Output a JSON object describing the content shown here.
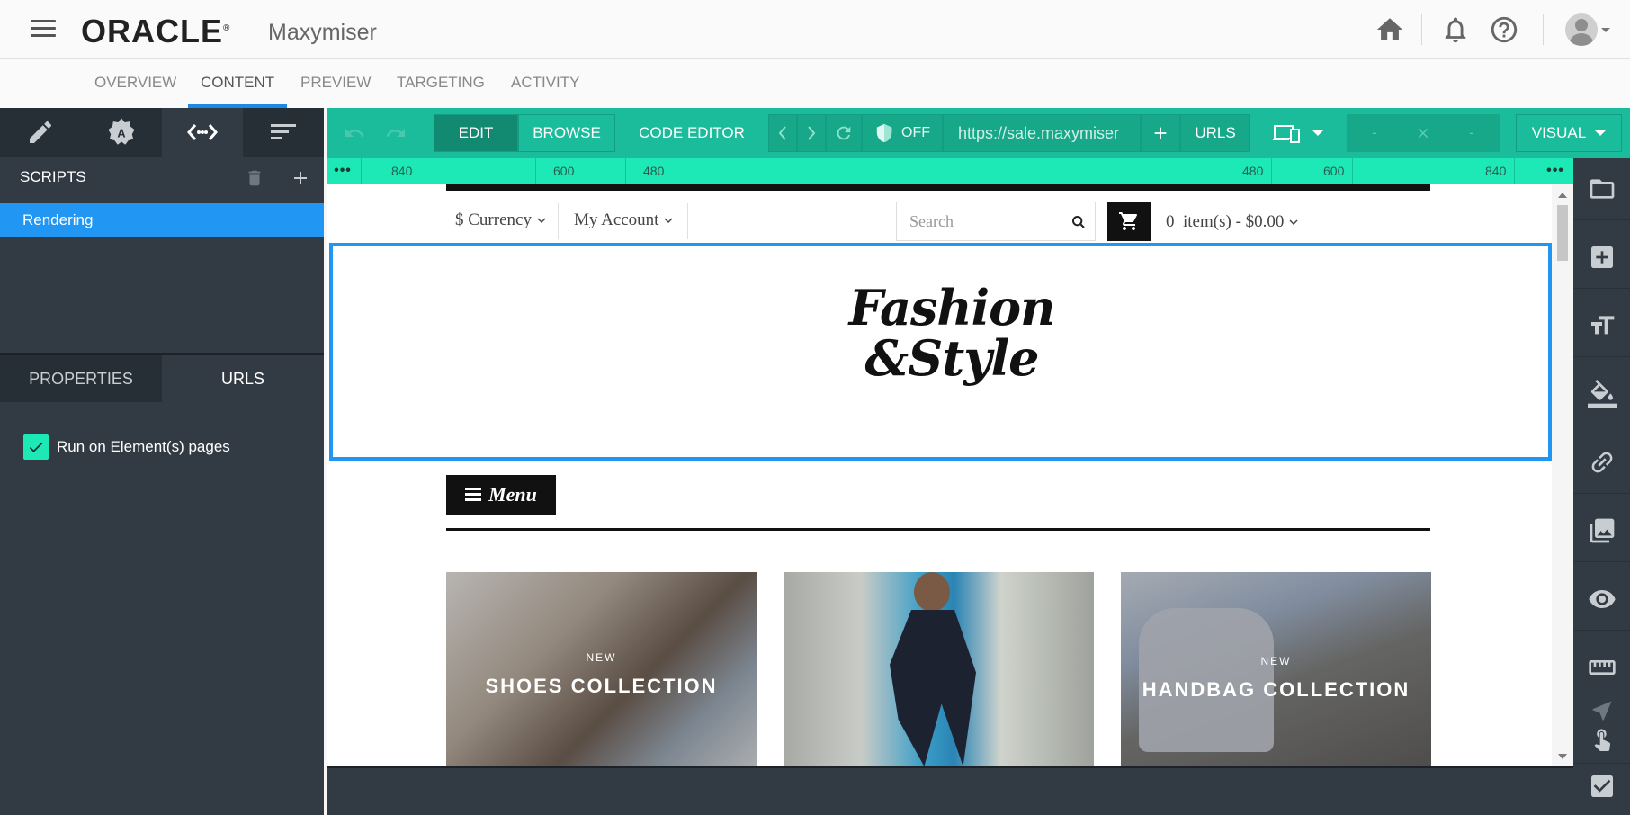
{
  "header": {
    "brand": "ORACLE",
    "brand_reg": "®",
    "product": "Maxymiser"
  },
  "nav": {
    "tabs": [
      {
        "label": "OVERVIEW"
      },
      {
        "label": "CONTENT"
      },
      {
        "label": "PREVIEW"
      },
      {
        "label": "TARGETING"
      },
      {
        "label": "ACTIVITY"
      }
    ],
    "active": "CONTENT"
  },
  "left_panel": {
    "section_title": "SCRIPTS",
    "scripts": [
      {
        "label": "Rendering"
      }
    ],
    "bottom_tabs": [
      {
        "label": "PROPERTIES"
      },
      {
        "label": "URLS"
      }
    ],
    "active_bottom_tab": "URLS",
    "run_on_elements": {
      "label": "Run on Element(s) pages",
      "checked": true
    }
  },
  "toolbar": {
    "edit_label": "EDIT",
    "browse_label": "BROWSE",
    "code_editor_label": "CODE EDITOR",
    "toggle_label": "OFF",
    "url_value": "https://sale.maxymiser",
    "urls_label": "URLS",
    "dash1": "-",
    "dash2": "-",
    "view_label": "VISUAL"
  },
  "ruler": {
    "left_ticks": [
      "840",
      "600",
      "480"
    ],
    "right_ticks": [
      "480",
      "600",
      "840"
    ],
    "dots": "•••"
  },
  "site": {
    "currency": "$ Currency",
    "account": "My Account",
    "search_placeholder": "Search",
    "cart_count": "0",
    "cart_text": "item(s) - $0.00",
    "logo_line1": "Fashion",
    "logo_line2": "&Style",
    "menu_label": "Menu",
    "collections": [
      {
        "new": "NEW",
        "title": "SHOES COLLECTION"
      },
      {
        "new": "",
        "title": ""
      },
      {
        "new": "NEW",
        "title": "HANDBAG COLLECTION"
      }
    ]
  },
  "colors": {
    "accent_teal": "#1abc9c",
    "ruler_teal": "#1de9b6",
    "selection_blue": "#2196f3",
    "panel_dark": "#323b44"
  }
}
